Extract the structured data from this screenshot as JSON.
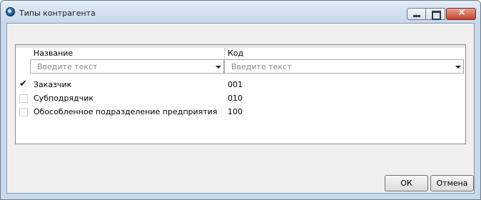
{
  "window": {
    "title": "Типы контрагента",
    "icon": "app-globe-icon",
    "controls": {
      "minimize": "minimize-icon",
      "maximize": "maximize-icon",
      "close": "close-icon"
    }
  },
  "grid": {
    "columns": [
      {
        "label": "Название",
        "filter_placeholder": "Введите текст"
      },
      {
        "label": "Код",
        "filter_placeholder": "Введите текст"
      }
    ],
    "rows": [
      {
        "checked": true,
        "name": "Заказчик",
        "code": "001"
      },
      {
        "checked": false,
        "name": "Субподрядчик",
        "code": "010"
      },
      {
        "checked": false,
        "name": "Обособленное подразделение предприятия",
        "code": "100"
      }
    ]
  },
  "buttons": {
    "ok": "ОК",
    "cancel": "Отмена"
  }
}
